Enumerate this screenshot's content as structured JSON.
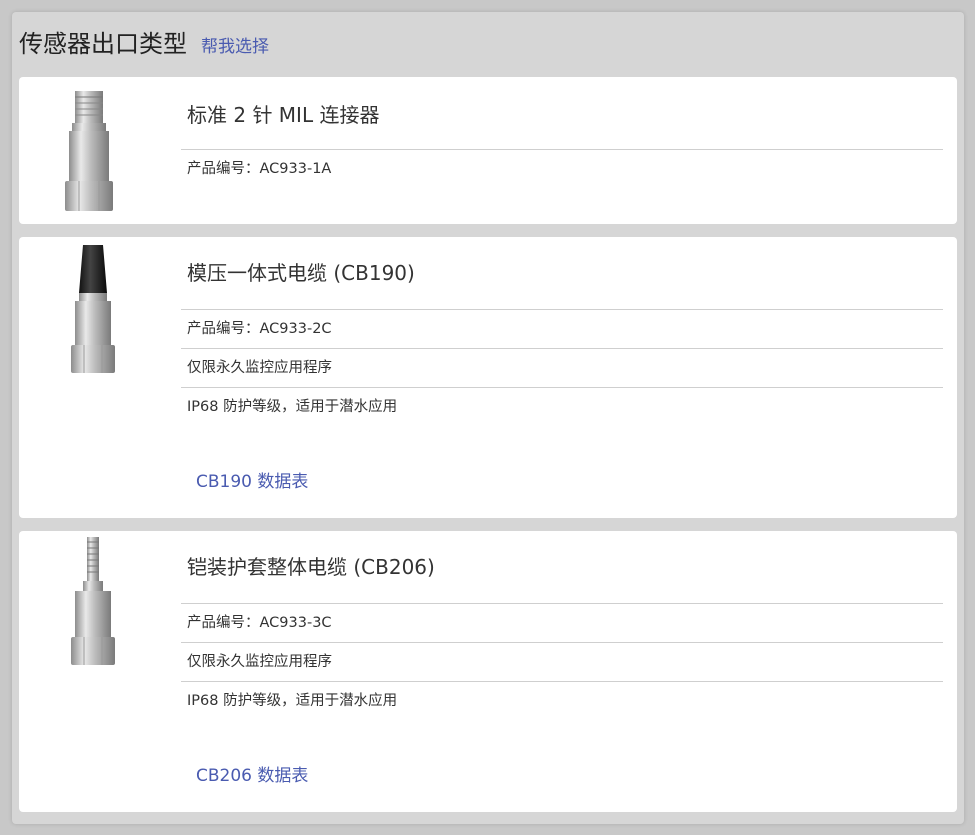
{
  "header": {
    "title": "传感器出口类型",
    "help_link": "帮我选择"
  },
  "products": [
    {
      "title": "标准 2 针 MIL 连接器",
      "part_number": "产品编号：AC933-1A"
    },
    {
      "title": "模压一体式电缆 (CB190)",
      "part_number": "产品编号：AC933-2C",
      "note1": "仅限永久监控应用程序",
      "note2": "IP68 防护等级，适用于潜水应用",
      "datasheet": "CB190 数据表"
    },
    {
      "title": "铠装护套整体电缆 (CB206)",
      "part_number": "产品编号：AC933-3C",
      "note1": "仅限永久监控应用程序",
      "note2": "IP68 防护等级，适用于潜水应用",
      "datasheet": "CB206 数据表"
    }
  ]
}
